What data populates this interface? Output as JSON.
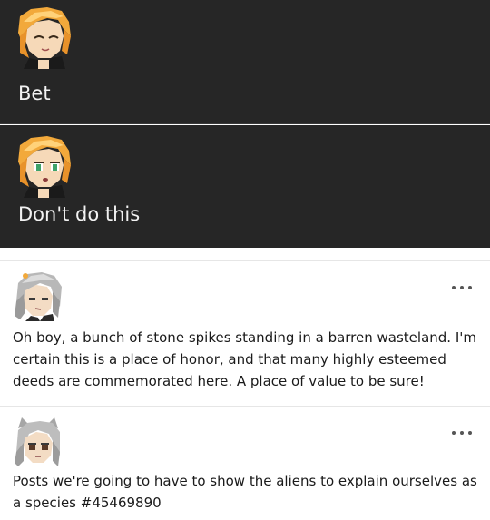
{
  "messages": [
    {
      "text": "Bet",
      "avatar_icon": "orange-haired-character-smiling-icon"
    },
    {
      "text": "Don't do this",
      "avatar_icon": "orange-haired-character-worried-icon"
    }
  ],
  "posts": [
    {
      "avatar_icon": "gray-haired-character-icon",
      "text": "Oh boy, a bunch of stone spikes standing in a barren wasteland. I'm certain this is a place of honor, and that many highly esteemed deeds are commemorated here. A place of value to be sure!"
    },
    {
      "avatar_icon": "gray-haired-catgirl-icon",
      "text": "Posts we're going to have to show the aliens to explain ourselves as a species #45469890"
    }
  ],
  "colors": {
    "dark_background": "#262626",
    "dark_text": "#f2f2f2",
    "post_background": "#ffffff",
    "post_text": "#1a1a1a"
  }
}
